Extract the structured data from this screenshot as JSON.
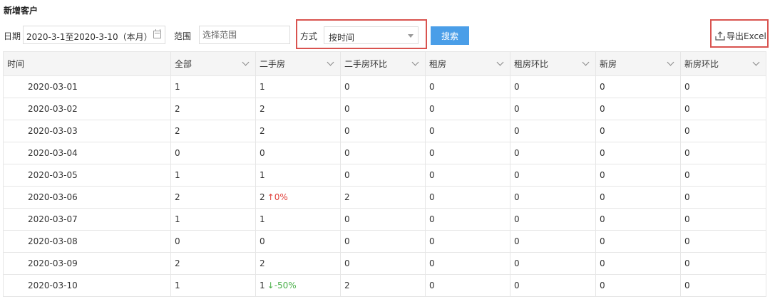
{
  "page": {
    "title": "新增客户"
  },
  "filters": {
    "date_label": "日期",
    "date_value": "2020-3-1至2020-3-10（本月）",
    "range_label": "范围",
    "range_placeholder": "选择范围",
    "mode_label": "方式",
    "mode_value": "按时间",
    "search_label": "搜索"
  },
  "toolbar": {
    "export_label": "导出Excel"
  },
  "table": {
    "columns": [
      "时间",
      "全部",
      "二手房",
      "二手房环比",
      "租房",
      "租房环比",
      "新房",
      "新房环比"
    ],
    "rows": [
      {
        "date": "2020-03-01",
        "all": "1",
        "second": "1",
        "second_trend": "",
        "second_ratio": "0",
        "rent": "0",
        "rent_ratio": "0",
        "new": "0",
        "new_ratio": "0"
      },
      {
        "date": "2020-03-02",
        "all": "2",
        "second": "2",
        "second_trend": "",
        "second_ratio": "0",
        "rent": "0",
        "rent_ratio": "0",
        "new": "0",
        "new_ratio": "0"
      },
      {
        "date": "2020-03-03",
        "all": "2",
        "second": "2",
        "second_trend": "",
        "second_ratio": "0",
        "rent": "0",
        "rent_ratio": "0",
        "new": "0",
        "new_ratio": "0"
      },
      {
        "date": "2020-03-04",
        "all": "0",
        "second": "0",
        "second_trend": "",
        "second_ratio": "0",
        "rent": "0",
        "rent_ratio": "0",
        "new": "0",
        "new_ratio": "0"
      },
      {
        "date": "2020-03-05",
        "all": "1",
        "second": "1",
        "second_trend": "",
        "second_ratio": "0",
        "rent": "0",
        "rent_ratio": "0",
        "new": "0",
        "new_ratio": "0"
      },
      {
        "date": "2020-03-06",
        "all": "2",
        "second": "2",
        "second_trend": "↑0%",
        "second_ratio": "2",
        "rent": "0",
        "rent_ratio": "0",
        "new": "0",
        "new_ratio": "0"
      },
      {
        "date": "2020-03-07",
        "all": "1",
        "second": "1",
        "second_trend": "",
        "second_ratio": "0",
        "rent": "0",
        "rent_ratio": "0",
        "new": "0",
        "new_ratio": "0"
      },
      {
        "date": "2020-03-08",
        "all": "0",
        "second": "0",
        "second_trend": "",
        "second_ratio": "0",
        "rent": "0",
        "rent_ratio": "0",
        "new": "0",
        "new_ratio": "0"
      },
      {
        "date": "2020-03-09",
        "all": "2",
        "second": "2",
        "second_trend": "",
        "second_ratio": "0",
        "rent": "0",
        "rent_ratio": "0",
        "new": "0",
        "new_ratio": "0"
      },
      {
        "date": "2020-03-10",
        "all": "1",
        "second": "1",
        "second_trend": "↓-50%",
        "second_ratio": "2",
        "rent": "0",
        "rent_ratio": "0",
        "new": "0",
        "new_ratio": "0"
      }
    ]
  },
  "colors": {
    "accent": "#4a9ee8",
    "highlight_border": "#d9534f",
    "trend_up": "#e0403a",
    "trend_down": "#4bb04a"
  },
  "icons": {
    "calendar": "calendar-icon",
    "dropdown": "caret-down-icon",
    "export": "export-icon",
    "column_menu": "chevron-down-icon"
  }
}
